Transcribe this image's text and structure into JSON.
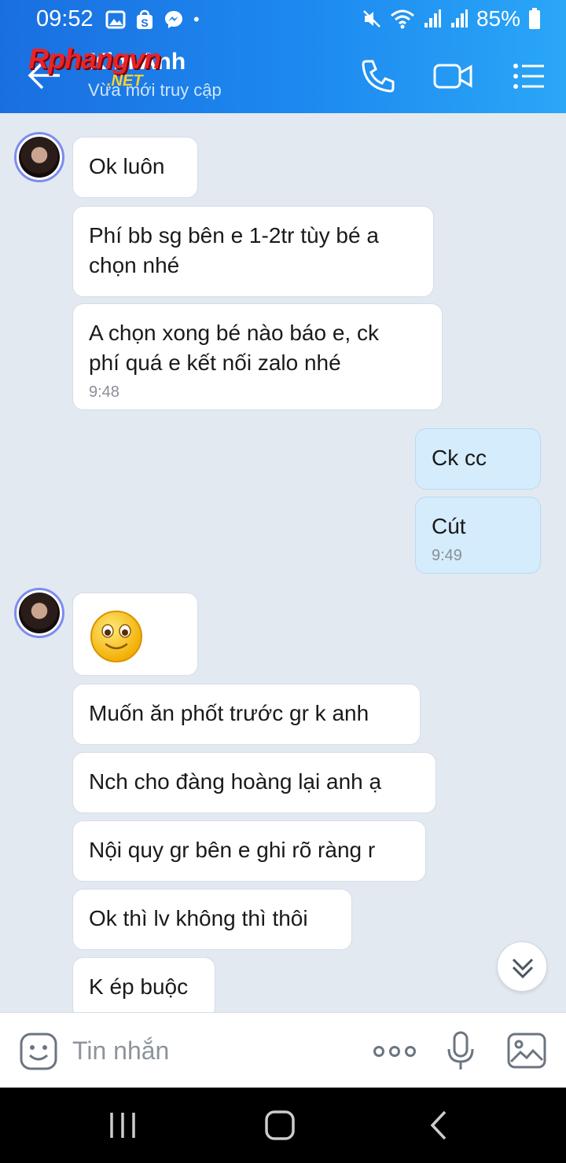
{
  "status_bar": {
    "time": "09:52",
    "battery": "85%"
  },
  "header": {
    "watermark": "Rphangvn",
    "watermark_net": ".NET",
    "contact_name": "Kim Anh",
    "contact_status": "Vừa mới truy cập"
  },
  "messages": {
    "m1": "Ok luôn",
    "m2a": "Phí bb sg bên e 1-2tr tùy bé a",
    "m2b": "chọn nhé",
    "m3a": "A chọn xong bé nào báo e,  ck",
    "m3b": "phí quá e kết nối zalo nhé",
    "m3_time": "9:48",
    "m4": "Ck cc",
    "m5": "Cút",
    "m5_time": "9:49",
    "m7": "Muốn ăn phốt trước gr k anh",
    "m8": "Nch cho đàng hoàng lại anh ạ",
    "m9": "Nội quy gr bên e ghi rõ ràng r",
    "m10": "Ok thì lv không thì thôi",
    "m11": "K ép buộc"
  },
  "input": {
    "placeholder": "Tin nhắn"
  },
  "colors": {
    "header_start": "#1a6fe0",
    "header_end": "#2aa6f7",
    "chat_bg": "#e2e9f1",
    "my_bubble": "#d5ecfd"
  }
}
